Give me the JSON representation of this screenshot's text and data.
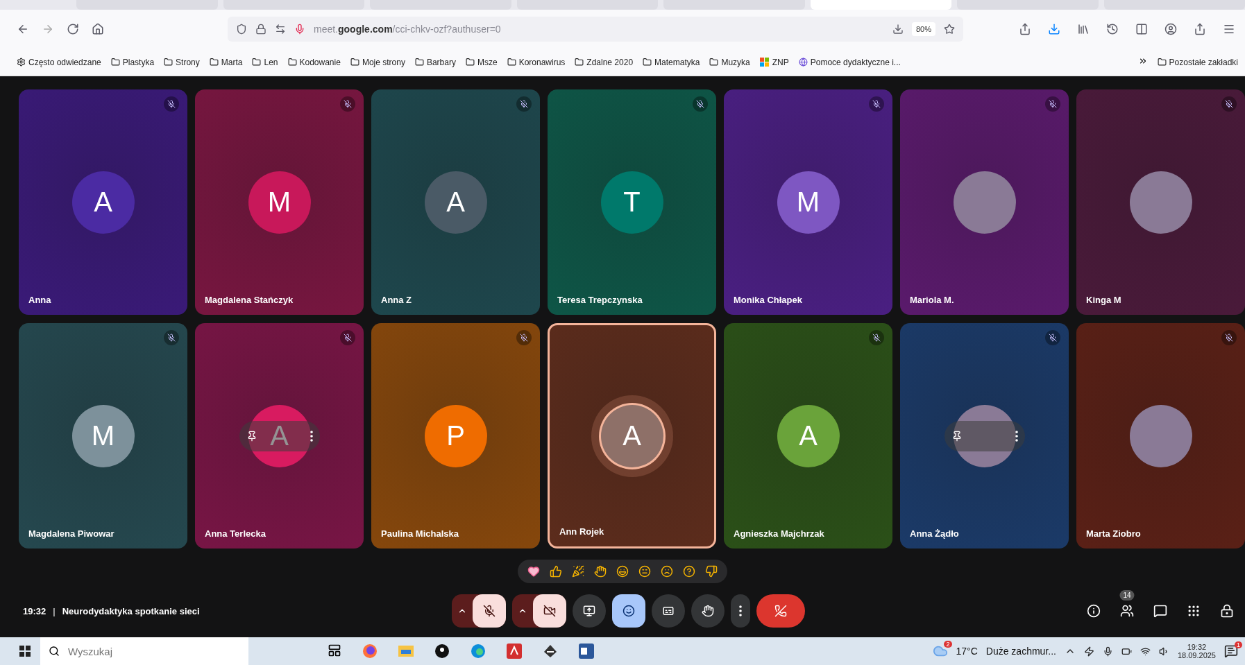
{
  "browser": {
    "tabs": [
      {
        "selected": false
      },
      {
        "selected": false
      },
      {
        "selected": false
      },
      {
        "selected": false
      },
      {
        "selected": false
      },
      {
        "selected": true
      },
      {
        "selected": false
      },
      {
        "selected": false
      }
    ],
    "url": "meet.**google.com**/cci-chkv-ozf?authuser=0",
    "zoom": "80%",
    "bookmarks": [
      {
        "kind": "gear",
        "label": "Często odwiedzane"
      },
      {
        "kind": "folder",
        "label": "Plastyka"
      },
      {
        "kind": "folder",
        "label": "Strony"
      },
      {
        "kind": "folder",
        "label": "Marta"
      },
      {
        "kind": "folder",
        "label": "Len"
      },
      {
        "kind": "folder",
        "label": "Kodowanie"
      },
      {
        "kind": "folder",
        "label": "Moje strony"
      },
      {
        "kind": "folder",
        "label": "Barbary"
      },
      {
        "kind": "folder",
        "label": "Msze"
      },
      {
        "kind": "folder",
        "label": "Koronawirus"
      },
      {
        "kind": "folder",
        "label": "Zdalne 2020"
      },
      {
        "kind": "folder",
        "label": "Matematyka"
      },
      {
        "kind": "folder",
        "label": "Muzyka"
      },
      {
        "kind": "windows",
        "label": "ZNP"
      },
      {
        "kind": "globe",
        "label": "Pomoce dydaktyczne i..."
      }
    ],
    "other_bookmarks": "Pozostałe zakładki"
  },
  "participants": [
    {
      "name": "Anna",
      "kind": "initial",
      "color": "#3a1a78",
      "avatar": {
        "initial": "A",
        "color": "#4b2ba3"
      },
      "muted": true,
      "speaking": false,
      "hover": false
    },
    {
      "name": "Magdalena Stańczyk",
      "kind": "initial",
      "color": "#781640",
      "avatar": {
        "initial": "M",
        "color": "#c8185a"
      },
      "muted": true,
      "speaking": false,
      "hover": false
    },
    {
      "name": "Anna Z",
      "kind": "initial",
      "color": "#1e474d",
      "avatar": {
        "initial": "A",
        "color": "#4a5a66"
      },
      "muted": true,
      "speaking": false,
      "hover": false
    },
    {
      "name": "Teresa Trepczynska",
      "kind": "initial",
      "color": "#0e5647",
      "avatar": {
        "initial": "T",
        "color": "#00796b"
      },
      "muted": true,
      "speaking": false,
      "hover": false
    },
    {
      "name": "Monika Chłapek",
      "kind": "initial",
      "color": "#4a1f82",
      "avatar": {
        "initial": "M",
        "color": "#7e57c2"
      },
      "muted": true,
      "speaking": false,
      "hover": false
    },
    {
      "name": "Mariola M.",
      "kind": "photo",
      "color": "#5a1a6c",
      "muted": true,
      "speaking": false,
      "hover": false
    },
    {
      "name": "Kinga M",
      "kind": "photo",
      "color": "#4a1a3a",
      "muted": true,
      "speaking": false,
      "hover": false
    },
    {
      "name": "Magdalena Piwowar",
      "kind": "initial",
      "color": "#25484f",
      "avatar": {
        "initial": "M",
        "color": "#7d919b"
      },
      "muted": true,
      "speaking": false,
      "hover": false
    },
    {
      "name": "Anna Terlecka",
      "kind": "initial",
      "color": "#781545",
      "avatar": {
        "initial": "A",
        "color": "#d81b60"
      },
      "muted": true,
      "speaking": false,
      "hover": true
    },
    {
      "name": "Paulina Michalska",
      "kind": "initial",
      "color": "#86470c",
      "avatar": {
        "initial": "P",
        "color": "#ef6c00"
      },
      "muted": true,
      "speaking": false,
      "hover": false
    },
    {
      "name": "Ann Rojek",
      "kind": "initial",
      "color": "#5c2c1c",
      "avatar": {
        "initial": "A",
        "color": "#8e7068"
      },
      "muted": false,
      "speaking": true,
      "hover": false
    },
    {
      "name": "Agnieszka Majchrzak",
      "kind": "initial",
      "color": "#2b5018",
      "avatar": {
        "initial": "A",
        "color": "#6aa33a"
      },
      "muted": true,
      "speaking": false,
      "hover": false
    },
    {
      "name": "Anna Żądło",
      "kind": "photo",
      "color": "#1b3a68",
      "muted": true,
      "speaking": false,
      "hover": true
    },
    {
      "name": "Marta Ziobro",
      "kind": "photo",
      "color": "#5a2016",
      "muted": true,
      "speaking": false,
      "hover": false
    }
  ],
  "meeting": {
    "time": "19:32",
    "separator": "|",
    "title": "Neurodydaktyka spotkanie sieci",
    "mic_on": false,
    "camera_on": false,
    "reactions_open": true,
    "people_count": "14"
  },
  "taskbar": {
    "search_placeholder": "Wyszukaj",
    "weather_badge": "2",
    "temperature": "17°C",
    "weather": "Duże zachmur...",
    "time": "19:32",
    "date": "18.09.2025",
    "notifications": "1"
  }
}
